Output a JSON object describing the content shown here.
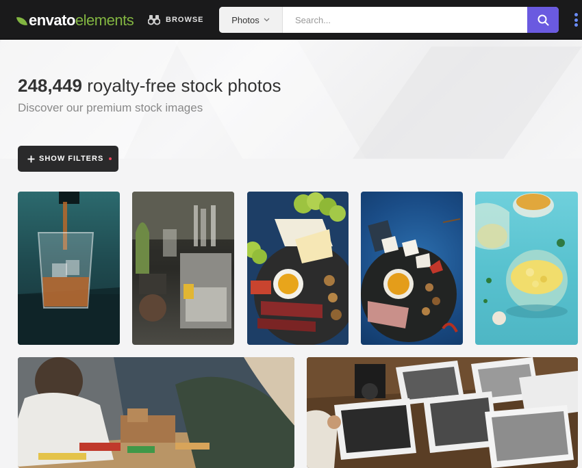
{
  "header": {
    "logo_main": "envato",
    "logo_accent": "elements",
    "browse_label": "BROWSE",
    "search": {
      "category": "Photos",
      "placeholder": "Search..."
    }
  },
  "hero": {
    "count": "248,449",
    "title_rest": "royalty-free stock photos",
    "subtitle": "Discover our premium stock images"
  },
  "filters": {
    "label": "SHOW FILTERS"
  },
  "photos": [
    {
      "subject": "whiskey being poured into glass"
    },
    {
      "subject": "bar counter with garnishes"
    },
    {
      "subject": "cheese and charcuterie board"
    },
    {
      "subject": "charcuterie on blue background"
    },
    {
      "subject": "bowl of food on turquoise table"
    },
    {
      "subject": "children playing with wooden blocks"
    },
    {
      "subject": "black and white photo prints with camera"
    }
  ],
  "colors": {
    "header_bg": "#1a1a1b",
    "brand_green": "#82b541",
    "search_button": "#6a5ae0",
    "filters_dot": "#e8455b"
  }
}
